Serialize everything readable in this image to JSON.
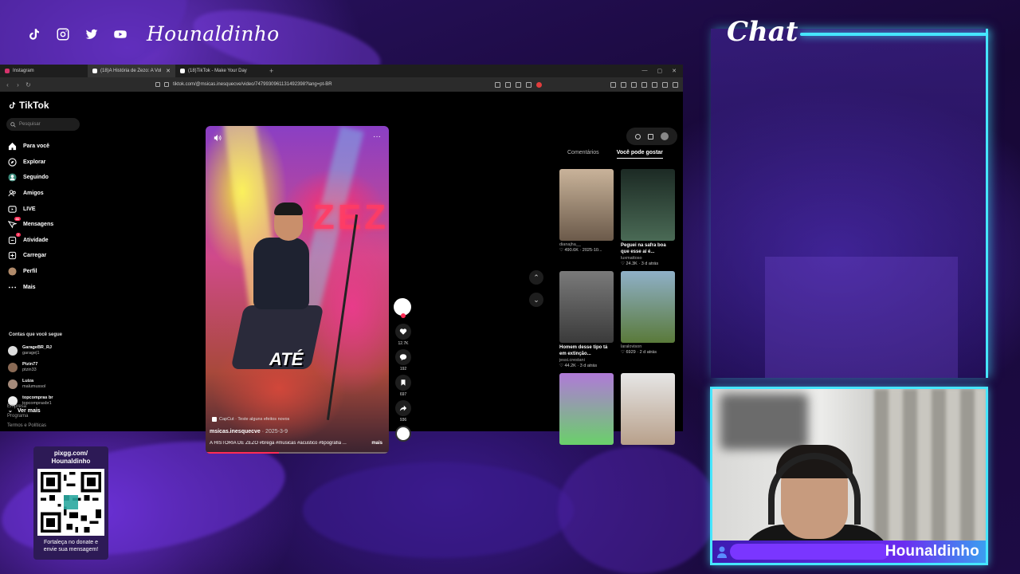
{
  "overlay": {
    "brand": "Hounaldinho",
    "chat_title": "Chat",
    "cam_name": "Hounaldinho",
    "donate_top_line1": "pixgg.com/",
    "donate_top_line2": "Hounaldinho",
    "donate_bottom_line1": "Fortaleça no donate e",
    "donate_bottom_line2": "envie sua mensagem!",
    "accent": "#46e6ff",
    "social_icons": [
      "tiktok-icon",
      "instagram-icon",
      "twitter-icon",
      "youtube-icon"
    ]
  },
  "browser": {
    "tabs": [
      {
        "label": "Instagram",
        "color": "#d6336c"
      },
      {
        "label": "(18)A História de Zezo: A Vol",
        "color": "#ffffff"
      },
      {
        "label": "(18)TikTok - Make Your Day",
        "color": "#ffffff"
      }
    ],
    "url": "tiktok.com/@msicas.inesquecve/video/7479930961131492398?lang=pt-BR"
  },
  "tiktok": {
    "logo": "TikTok",
    "search_placeholder": "Pesquisar",
    "menu": [
      {
        "label": "Para você",
        "icon": "home-icon"
      },
      {
        "label": "Explorar",
        "icon": "compass-icon"
      },
      {
        "label": "Seguindo",
        "icon": "following-icon"
      },
      {
        "label": "Amigos",
        "icon": "friends-icon"
      },
      {
        "label": "LIVE",
        "icon": "live-icon"
      },
      {
        "label": "Mensagens",
        "icon": "messages-icon",
        "badge": "41"
      },
      {
        "label": "Atividade",
        "icon": "activity-icon",
        "badge": "7"
      },
      {
        "label": "Carregar",
        "icon": "upload-icon"
      },
      {
        "label": "Perfil",
        "icon": "profile-icon"
      },
      {
        "label": "Mais",
        "icon": "more-icon"
      }
    ],
    "following_title": "Contas que você segue",
    "following": [
      {
        "name": "GarageBR_RJ",
        "handle": "garage|1",
        "color": "#ddd"
      },
      {
        "name": "Ptzin77",
        "handle": "ptzin33",
        "color": "#8a6a55"
      },
      {
        "name": "Luiza",
        "handle": "malumussol",
        "color": "#a58a7a"
      },
      {
        "name": "topcompras br",
        "handle": "topcomprasbr1",
        "color": "#eee"
      }
    ],
    "see_more": "Ver mais",
    "footer": [
      "Empresa",
      "Programa",
      "Termos e Políticas"
    ]
  },
  "video": {
    "overlay_text": "ATÉ",
    "neon": "ZEZ",
    "capcut": "CapCut · Teste alguns efeitos novos",
    "username": "msicas.inesquecve",
    "date": " · 2025-3-9",
    "description": "A HISTÓRIA DE ZEZO #brega #musicas #acustico #tipografia ...",
    "more": "mais",
    "progress": 0.4,
    "likes": "12.7K",
    "comments": "192",
    "saves": "697",
    "shares": "936"
  },
  "right_panel": {
    "tab_comments": "Comentários",
    "tab_suggest": "Você pode gostar",
    "cards": [
      {
        "title": "",
        "author": "dianajha__",
        "meta": "♡ 490.6K · 2025-10...",
        "bg": "linear-gradient(180deg,#c9b39a,#6b5a4a)"
      },
      {
        "title": "Peguei na safra boa que esse aí é...",
        "author": "luxmattoso",
        "meta": "♡ 24.3K · 3 d atrás",
        "bg": "linear-gradient(180deg,#1c2a24,#4a6a55)"
      },
      {
        "title": "Homem desse tipo tá em extinção...",
        "author": "jessi.crestani",
        "meta": "♡ 44.2K · 3 d atrás",
        "bg": "linear-gradient(180deg,#7a7a7a,#3a3a3a)"
      },
      {
        "title": "",
        "author": "laralovison",
        "meta": "♡ 6929 · 2 d atrás",
        "bg": "linear-gradient(180deg,#8fb0c8,#5a7a3a)"
      },
      {
        "title": "",
        "author": "",
        "meta": "",
        "bg": "linear-gradient(180deg,#b07ad8,#6ad06a)"
      },
      {
        "title": "",
        "author": "",
        "meta": "",
        "bg": "linear-gradient(180deg,#e6e6e6,#b8a08a)"
      }
    ]
  }
}
